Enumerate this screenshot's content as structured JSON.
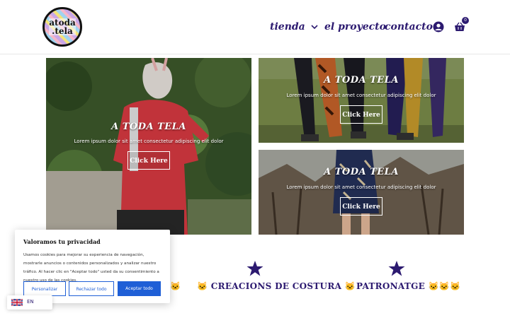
{
  "header": {
    "logo_line1": "atoda",
    "logo_line2": ".tela",
    "nav": {
      "tienda": "tienda",
      "proyecto": "el proyecto",
      "contacto": "contacto"
    },
    "cart_count": "0",
    "icons": {
      "chevron": "chevron-down-icon",
      "account": "user-icon",
      "cart": "basket-icon"
    }
  },
  "panels": [
    {
      "title": "A TODA TELA",
      "subtitle": "Lorem ipsum dolor sit amet consectetur adipiscing elit dolor",
      "button": "Click Here"
    },
    {
      "title": "A TODA TELA",
      "subtitle": "Lorem ipsum dolor sit amet consectetur adipiscing elit dolor",
      "button": "Click Here"
    },
    {
      "title": "A TODA TELA",
      "subtitle": "Lorem ipsum dolor sit amet consectetur adipiscing elit dolor",
      "button": "Click Here"
    }
  ],
  "features": {
    "costura": "🐱 CREACIONS DE COSTURA 🐱",
    "patronatge": "PATRONATGE 🐱🐱🐱",
    "left_partial": "🐱"
  },
  "cookie": {
    "title": "Valoramos tu privacidad",
    "text": "Usamos cookies para mejorar su experiencia de navegación, mostrarle anuncios o contenidos personalizados y analizar nuestro tráfico. Al hacer clic en \"Aceptar todo\" usted da su consentimiento a nuestro uso de las cookies.",
    "customize": "Personalizar",
    "reject": "Rechazar todo",
    "accept": "Aceptar todo"
  },
  "lang": {
    "code": "EN"
  },
  "colors": {
    "brand": "#2c1a70",
    "accept_button": "#1f5fd6"
  }
}
